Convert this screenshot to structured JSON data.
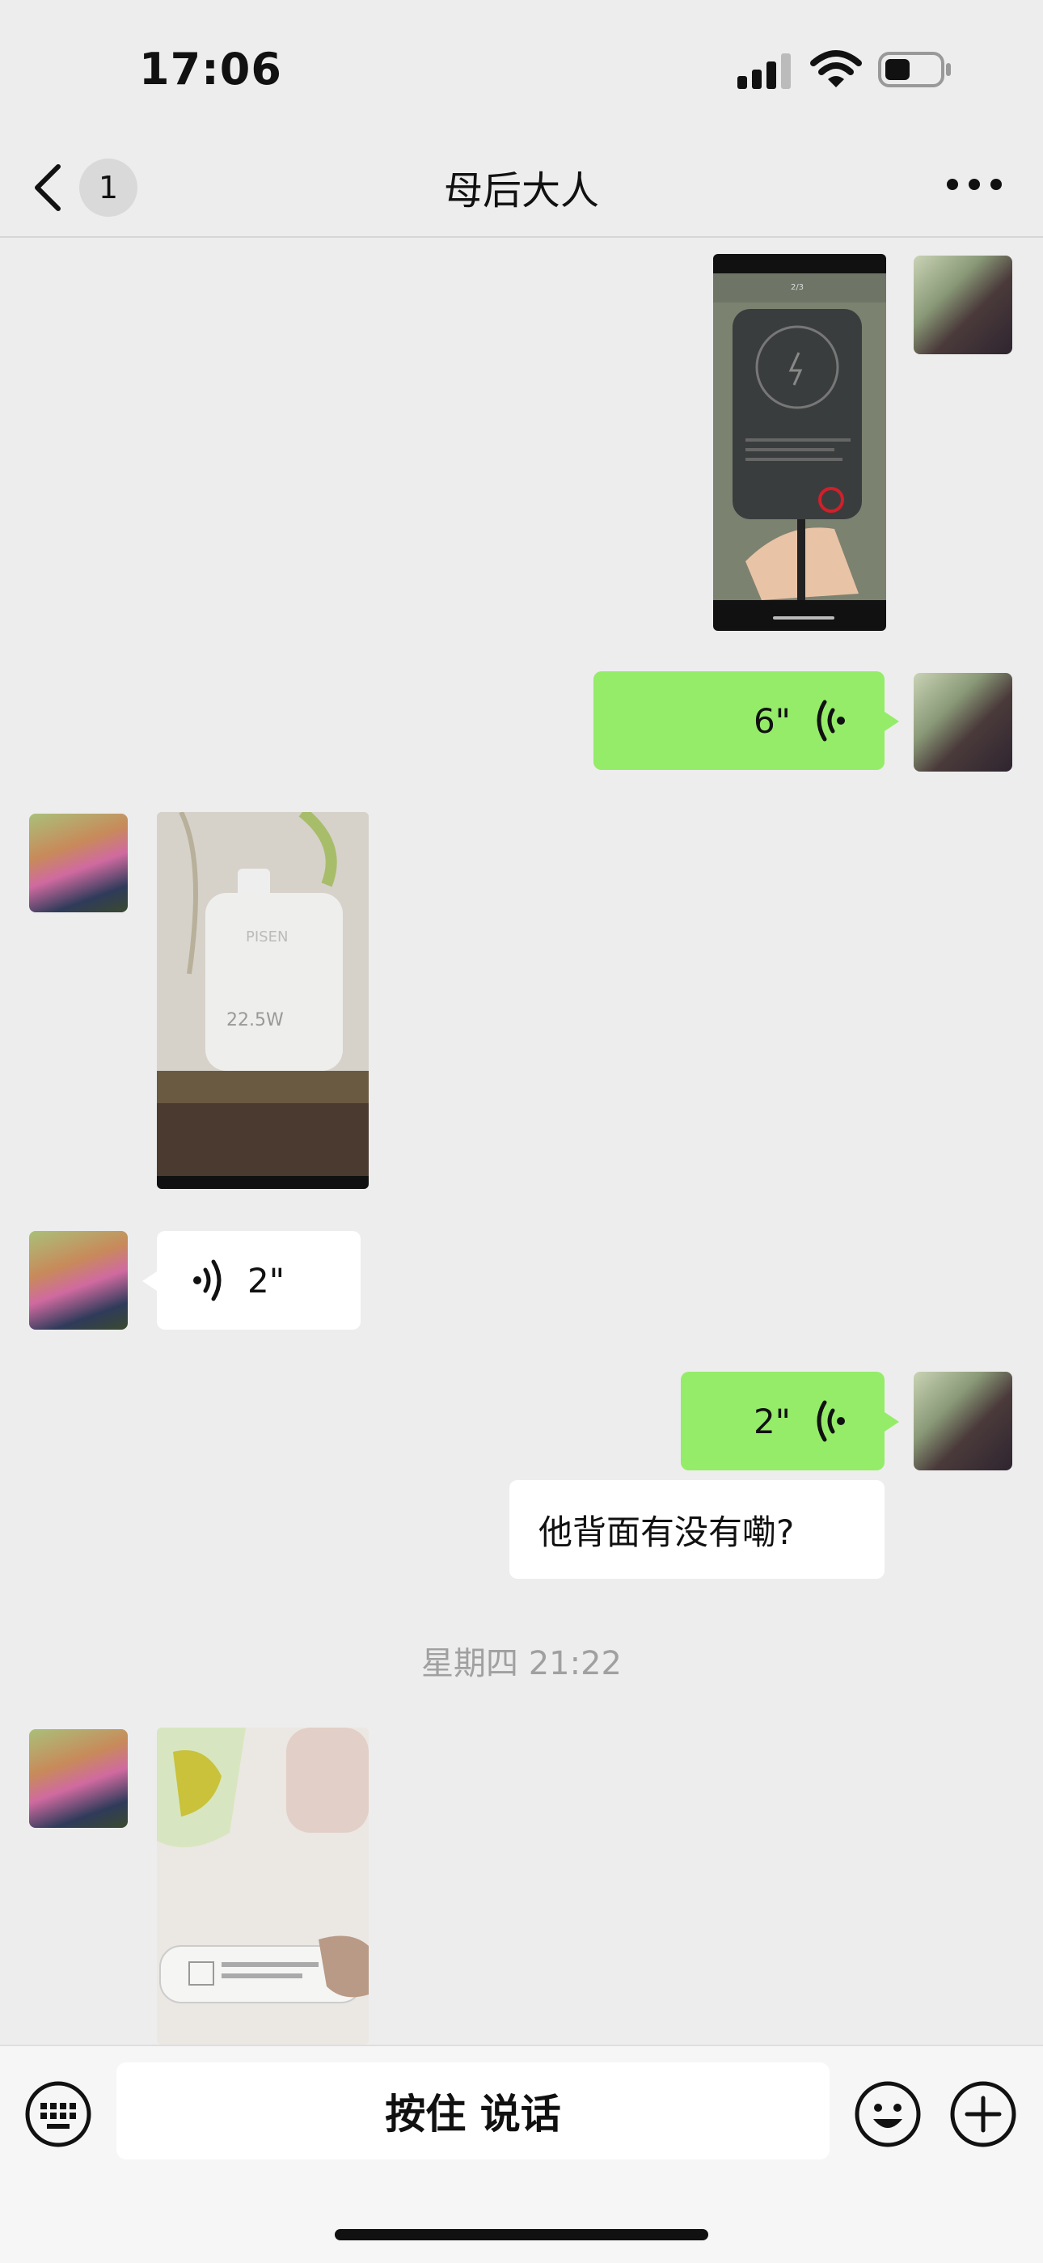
{
  "status_bar": {
    "time": "17:06"
  },
  "nav": {
    "unread_count": "1",
    "title": "母后大人"
  },
  "messages": {
    "msg2_voice_duration": "6\"",
    "msg4_voice_duration": "2\"",
    "msg5_voice_duration": "2\"",
    "msg6_text": "他背面有没有嘞?",
    "timestamp": "星期四 21:22",
    "img1_caption": "2/3",
    "img2_brand": "PISEN",
    "img2_watt": "22.5W"
  },
  "input_bar": {
    "talk_label": "按住 说话"
  },
  "colors": {
    "my_bubble": "#95ec69",
    "their_bubble": "#ffffff",
    "background": "#ededed"
  }
}
